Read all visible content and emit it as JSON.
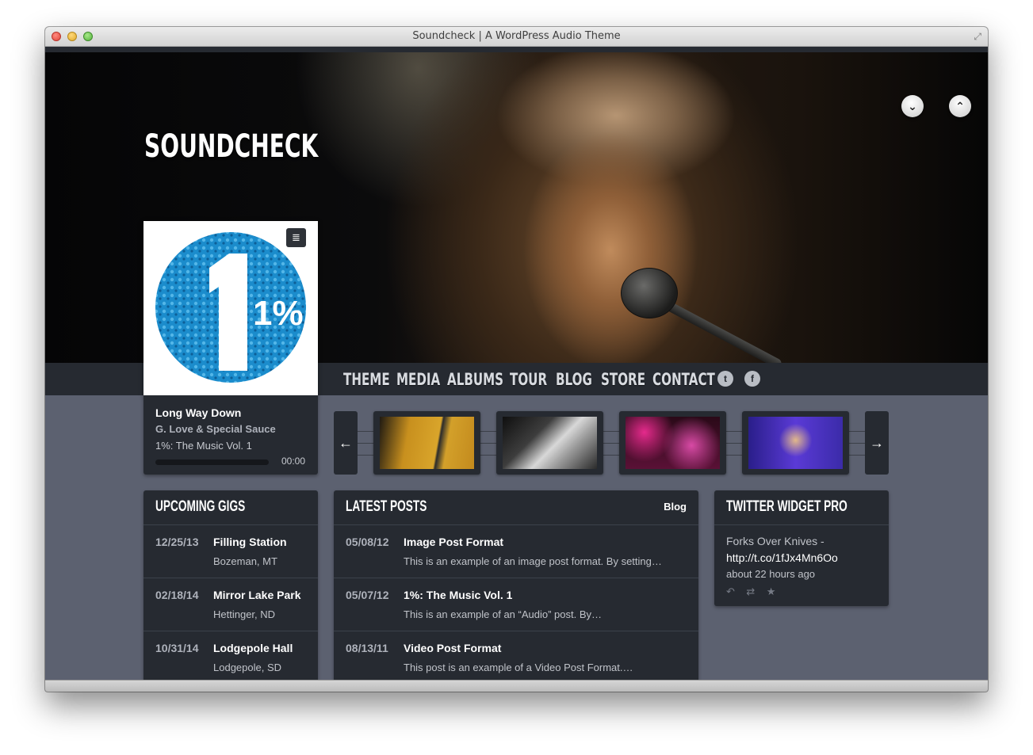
{
  "window": {
    "title": "Soundcheck | A WordPress Audio Theme"
  },
  "site": {
    "logo": "SOUNDCHECK"
  },
  "nav": {
    "items": [
      "THEME",
      "MEDIA",
      "ALBUMS",
      "TOUR",
      "BLOG",
      "STORE",
      "CONTACT"
    ],
    "social": [
      "twitter-icon",
      "facebook-icon"
    ]
  },
  "album": {
    "art_text": "1%"
  },
  "player": {
    "track": "Long Way Down",
    "artist": "G. Love & Special Sauce",
    "album": "1%: The Music Vol. 1",
    "time": "00:00",
    "progress": 0
  },
  "carousel": {
    "prev_icon": "arrow-left-icon",
    "next_icon": "arrow-right-icon",
    "thumbnails": [
      "album-poster-photo",
      "backstage-photo",
      "band-stage-photo",
      "guitarist-concert-photo"
    ]
  },
  "gigs": {
    "title": "UPCOMING GIGS",
    "items": [
      {
        "date": "12/25/13",
        "venue": "Filling Station",
        "location": "Bozeman, MT"
      },
      {
        "date": "02/18/14",
        "venue": "Mirror Lake Park",
        "location": "Hettinger, ND"
      },
      {
        "date": "10/31/14",
        "venue": "Lodgepole Hall",
        "location": "Lodgepole, SD"
      }
    ]
  },
  "posts": {
    "title": "LATEST POSTS",
    "link": "Blog",
    "items": [
      {
        "date": "05/08/12",
        "title": "Image Post Format",
        "excerpt": "This is an example of an image post format. By setting…"
      },
      {
        "date": "05/07/12",
        "title": "1%: The Music Vol. 1",
        "excerpt": "This is an example of an “Audio” post. By…"
      },
      {
        "date": "08/13/11",
        "title": "Video Post Format",
        "excerpt": "This post is an example of a Video Post Format.…"
      }
    ]
  },
  "twitter": {
    "title": "TWITTER WIDGET PRO",
    "text": "Forks Over Knives -",
    "link": "http://t.co/1fJx4Mn6Oo",
    "time": "about 22 hours ago",
    "actions": [
      "reply-icon",
      "retweet-icon",
      "favorite-icon"
    ]
  }
}
